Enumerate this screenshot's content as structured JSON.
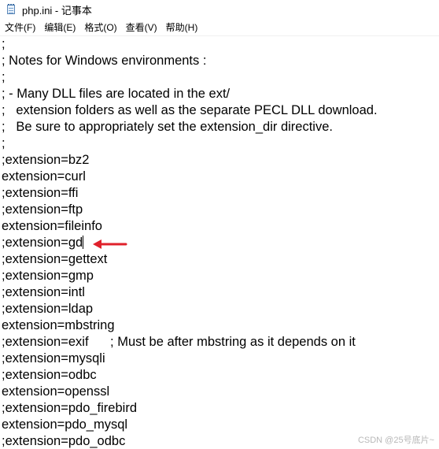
{
  "window": {
    "title": "php.ini - 记事本"
  },
  "menu": [
    {
      "label": "文件(F)"
    },
    {
      "label": "编辑(E)"
    },
    {
      "label": "格式(O)"
    },
    {
      "label": "查看(V)"
    },
    {
      "label": "帮助(H)"
    }
  ],
  "editor": {
    "lines": [
      ";",
      "; Notes for Windows environments :",
      ";",
      "; - Many DLL files are located in the ext/",
      ";   extension folders as well as the separate PECL DLL download.",
      ";   Be sure to appropriately set the extension_dir directive.",
      ";",
      ";extension=bz2",
      "extension=curl",
      ";extension=ffi",
      ";extension=ftp",
      "extension=fileinfo",
      ";extension=gd",
      ";extension=gettext",
      ";extension=gmp",
      ";extension=intl",
      ";extension=ldap",
      "extension=mbstring",
      ";extension=exif      ; Must be after mbstring as it depends on it",
      ";extension=mysqli",
      ";extension=odbc",
      "extension=openssl",
      ";extension=pdo_firebird",
      "extension=pdo_mysql",
      ";extension=pdo_odbc"
    ],
    "caret_line": 12
  },
  "annotation": {
    "arrow_color": "#e0212b"
  },
  "watermark": "CSDN @25号底片~"
}
